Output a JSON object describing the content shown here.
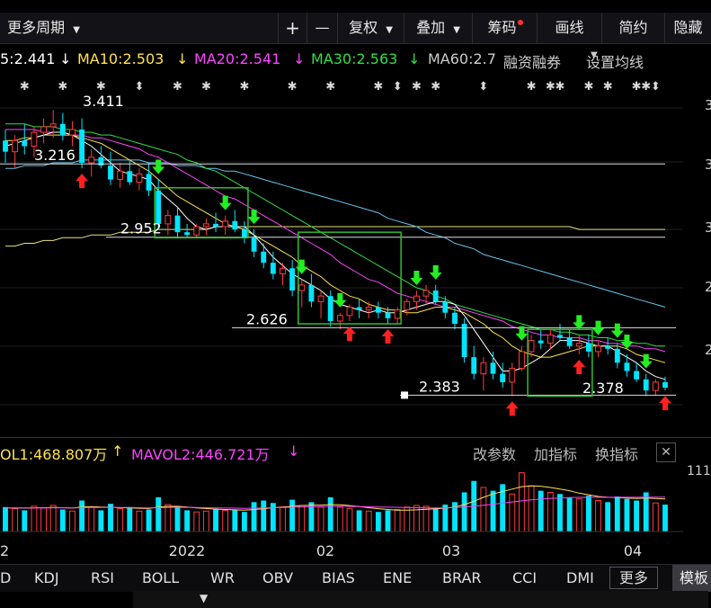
{
  "toolbar": {
    "period_label": "更多周期",
    "plus_label": "+",
    "minus_label": "—",
    "adjust_label": "复权",
    "overlay_label": "叠加",
    "chips_label": "筹码",
    "draw_label": "画线",
    "simple_label": "简约",
    "hide_label": "隐藏"
  },
  "ma_legend": {
    "ma5": "5:2.441",
    "ma10": "MA10:2.503",
    "ma20": "MA20:2.541",
    "ma30": "MA30:2.563",
    "ma60": "MA60:2.7",
    "margin_label": "融资融券",
    "settings_label": "设置均线",
    "arrow_down": "↓",
    "colors": {
      "ma5": "#ffffff",
      "ma10": "#ffe14d",
      "ma20": "#ff44ff",
      "ma30": "#33dd44",
      "ma60": "#cccccc"
    }
  },
  "vol_legend": {
    "mavol1": "OL1:468.807万",
    "mavol1_arrow": "↑",
    "mavol2": "MAVOL2:446.721万",
    "mavol2_arrow": "↓",
    "params_label": "改参数",
    "add_indicator_label": "加指标",
    "switch_indicator_label": "换指标",
    "close_label": "✕",
    "vol_axis_label": "111"
  },
  "indicators": {
    "items": [
      "D",
      "KDJ",
      "RSI",
      "BOLL",
      "WR",
      "OBV",
      "BIAS",
      "ENE",
      "BRAR",
      "CCI",
      "DMI"
    ],
    "more_label": "更多",
    "template_label": "模板"
  },
  "chart_data": {
    "type": "candlestick",
    "x_labels": [
      "2",
      "2022",
      "02",
      "03",
      "04"
    ],
    "price_annotations": [
      "3.411",
      "3.216",
      "2.952",
      "2.626",
      "2.383",
      "2.378"
    ],
    "right_axis_digits": [
      "3",
      "3",
      "3",
      "2",
      "2"
    ],
    "colors": {
      "up": "#ff3b3b",
      "down": "#00e5ff",
      "signal_up": "#ff2020",
      "signal_down": "#22ee22",
      "box": "#2fbf2f"
    },
    "candles": [
      {
        "o": 3.3,
        "h": 3.34,
        "l": 3.22,
        "c": 3.26
      },
      {
        "o": 3.26,
        "h": 3.32,
        "l": 3.2,
        "c": 3.3
      },
      {
        "o": 3.3,
        "h": 3.36,
        "l": 3.25,
        "c": 3.28
      },
      {
        "o": 3.28,
        "h": 3.35,
        "l": 3.24,
        "c": 3.33
      },
      {
        "o": 3.33,
        "h": 3.38,
        "l": 3.29,
        "c": 3.35
      },
      {
        "o": 3.35,
        "h": 3.41,
        "l": 3.31,
        "c": 3.36
      },
      {
        "o": 3.36,
        "h": 3.4,
        "l": 3.3,
        "c": 3.32
      },
      {
        "o": 3.32,
        "h": 3.37,
        "l": 3.28,
        "c": 3.34
      },
      {
        "o": 3.34,
        "h": 3.38,
        "l": 3.2,
        "c": 3.22
      },
      {
        "o": 3.22,
        "h": 3.27,
        "l": 3.17,
        "c": 3.24
      },
      {
        "o": 3.24,
        "h": 3.28,
        "l": 3.2,
        "c": 3.21
      },
      {
        "o": 3.21,
        "h": 3.26,
        "l": 3.14,
        "c": 3.16
      },
      {
        "o": 3.16,
        "h": 3.22,
        "l": 3.13,
        "c": 3.19
      },
      {
        "o": 3.19,
        "h": 3.23,
        "l": 3.14,
        "c": 3.15
      },
      {
        "o": 3.15,
        "h": 3.2,
        "l": 3.12,
        "c": 3.18
      },
      {
        "o": 3.18,
        "h": 3.22,
        "l": 3.1,
        "c": 3.12
      },
      {
        "o": 3.12,
        "h": 3.16,
        "l": 2.98,
        "c": 3.0
      },
      {
        "o": 3.0,
        "h": 3.05,
        "l": 2.96,
        "c": 3.03
      },
      {
        "o": 3.03,
        "h": 3.06,
        "l": 2.95,
        "c": 2.97
      },
      {
        "o": 2.97,
        "h": 3.0,
        "l": 2.95,
        "c": 2.96
      },
      {
        "o": 2.96,
        "h": 3.0,
        "l": 2.95,
        "c": 2.99
      },
      {
        "o": 2.99,
        "h": 3.02,
        "l": 2.96,
        "c": 3.0
      },
      {
        "o": 3.0,
        "h": 3.04,
        "l": 2.97,
        "c": 2.99
      },
      {
        "o": 2.99,
        "h": 3.03,
        "l": 2.96,
        "c": 3.01
      },
      {
        "o": 3.01,
        "h": 3.05,
        "l": 2.97,
        "c": 2.98
      },
      {
        "o": 2.98,
        "h": 3.01,
        "l": 2.93,
        "c": 2.95
      },
      {
        "o": 2.95,
        "h": 2.98,
        "l": 2.88,
        "c": 2.9
      },
      {
        "o": 2.9,
        "h": 2.93,
        "l": 2.84,
        "c": 2.86
      },
      {
        "o": 2.86,
        "h": 2.9,
        "l": 2.8,
        "c": 2.82
      },
      {
        "o": 2.82,
        "h": 2.86,
        "l": 2.78,
        "c": 2.84
      },
      {
        "o": 2.84,
        "h": 2.87,
        "l": 2.74,
        "c": 2.76
      },
      {
        "o": 2.76,
        "h": 2.8,
        "l": 2.7,
        "c": 2.78
      },
      {
        "o": 2.78,
        "h": 2.82,
        "l": 2.7,
        "c": 2.72
      },
      {
        "o": 2.72,
        "h": 2.76,
        "l": 2.66,
        "c": 2.74
      },
      {
        "o": 2.74,
        "h": 2.76,
        "l": 2.63,
        "c": 2.65
      },
      {
        "o": 2.65,
        "h": 2.68,
        "l": 2.62,
        "c": 2.67
      },
      {
        "o": 2.67,
        "h": 2.71,
        "l": 2.65,
        "c": 2.7
      },
      {
        "o": 2.7,
        "h": 2.73,
        "l": 2.66,
        "c": 2.69
      },
      {
        "o": 2.69,
        "h": 2.72,
        "l": 2.66,
        "c": 2.7
      },
      {
        "o": 2.7,
        "h": 2.72,
        "l": 2.66,
        "c": 2.68
      },
      {
        "o": 2.68,
        "h": 2.7,
        "l": 2.64,
        "c": 2.66
      },
      {
        "o": 2.66,
        "h": 2.7,
        "l": 2.64,
        "c": 2.69
      },
      {
        "o": 2.69,
        "h": 2.73,
        "l": 2.67,
        "c": 2.72
      },
      {
        "o": 2.72,
        "h": 2.76,
        "l": 2.69,
        "c": 2.74
      },
      {
        "o": 2.74,
        "h": 2.78,
        "l": 2.71,
        "c": 2.76
      },
      {
        "o": 2.76,
        "h": 2.78,
        "l": 2.71,
        "c": 2.72
      },
      {
        "o": 2.72,
        "h": 2.74,
        "l": 2.66,
        "c": 2.68
      },
      {
        "o": 2.68,
        "h": 2.7,
        "l": 2.62,
        "c": 2.64
      },
      {
        "o": 2.64,
        "h": 2.66,
        "l": 2.5,
        "c": 2.52
      },
      {
        "o": 2.52,
        "h": 2.56,
        "l": 2.44,
        "c": 2.46
      },
      {
        "o": 2.46,
        "h": 2.52,
        "l": 2.4,
        "c": 2.5
      },
      {
        "o": 2.5,
        "h": 2.54,
        "l": 2.44,
        "c": 2.46
      },
      {
        "o": 2.46,
        "h": 2.5,
        "l": 2.41,
        "c": 2.43
      },
      {
        "o": 2.43,
        "h": 2.5,
        "l": 2.38,
        "c": 2.48
      },
      {
        "o": 2.48,
        "h": 2.56,
        "l": 2.47,
        "c": 2.54
      },
      {
        "o": 2.54,
        "h": 2.6,
        "l": 2.52,
        "c": 2.58
      },
      {
        "o": 2.58,
        "h": 2.62,
        "l": 2.55,
        "c": 2.57
      },
      {
        "o": 2.57,
        "h": 2.62,
        "l": 2.55,
        "c": 2.6
      },
      {
        "o": 2.6,
        "h": 2.64,
        "l": 2.58,
        "c": 2.59
      },
      {
        "o": 2.59,
        "h": 2.62,
        "l": 2.55,
        "c": 2.56
      },
      {
        "o": 2.56,
        "h": 2.6,
        "l": 2.53,
        "c": 2.57
      },
      {
        "o": 2.57,
        "h": 2.6,
        "l": 2.52,
        "c": 2.54
      },
      {
        "o": 2.54,
        "h": 2.58,
        "l": 2.52,
        "c": 2.56
      },
      {
        "o": 2.56,
        "h": 2.59,
        "l": 2.53,
        "c": 2.55
      },
      {
        "o": 2.55,
        "h": 2.57,
        "l": 2.48,
        "c": 2.5
      },
      {
        "o": 2.5,
        "h": 2.53,
        "l": 2.45,
        "c": 2.47
      },
      {
        "o": 2.47,
        "h": 2.5,
        "l": 2.43,
        "c": 2.44
      },
      {
        "o": 2.44,
        "h": 2.46,
        "l": 2.38,
        "c": 2.4
      },
      {
        "o": 2.4,
        "h": 2.44,
        "l": 2.38,
        "c": 2.43
      },
      {
        "o": 2.43,
        "h": 2.45,
        "l": 2.4,
        "c": 2.41
      }
    ],
    "ma5": [
      3.28,
      3.29,
      3.3,
      3.31,
      3.32,
      3.33,
      3.33,
      3.32,
      3.3,
      3.28,
      3.25,
      3.22,
      3.19,
      3.18,
      3.17,
      3.16,
      3.12,
      3.09,
      3.06,
      3.02,
      2.99,
      2.98,
      2.99,
      2.99,
      2.99,
      2.99,
      2.96,
      2.92,
      2.88,
      2.85,
      2.82,
      2.8,
      2.78,
      2.76,
      2.73,
      2.71,
      2.7,
      2.69,
      2.68,
      2.69,
      2.68,
      2.68,
      2.69,
      2.7,
      2.71,
      2.72,
      2.72,
      2.71,
      2.67,
      2.62,
      2.57,
      2.52,
      2.47,
      2.47,
      2.48,
      2.5,
      2.52,
      2.55,
      2.58,
      2.58,
      2.58,
      2.57,
      2.56,
      2.56,
      2.54,
      2.52,
      2.5,
      2.47,
      2.45,
      2.44
    ],
    "ma10": [
      3.3,
      3.3,
      3.31,
      3.31,
      3.32,
      3.32,
      3.32,
      3.32,
      3.31,
      3.3,
      3.29,
      3.27,
      3.25,
      3.23,
      3.21,
      3.19,
      3.16,
      3.13,
      3.1,
      3.08,
      3.06,
      3.04,
      3.02,
      3.0,
      2.99,
      2.98,
      2.96,
      2.94,
      2.92,
      2.9,
      2.88,
      2.85,
      2.83,
      2.81,
      2.78,
      2.76,
      2.74,
      2.73,
      2.71,
      2.7,
      2.69,
      2.69,
      2.68,
      2.68,
      2.69,
      2.7,
      2.7,
      2.69,
      2.68,
      2.66,
      2.64,
      2.61,
      2.59,
      2.56,
      2.54,
      2.53,
      2.52,
      2.52,
      2.53,
      2.54,
      2.55,
      2.56,
      2.56,
      2.56,
      2.56,
      2.55,
      2.53,
      2.52,
      2.51,
      2.5
    ],
    "ma20": [
      3.34,
      3.34,
      3.34,
      3.34,
      3.33,
      3.33,
      3.33,
      3.32,
      3.32,
      3.31,
      3.31,
      3.3,
      3.29,
      3.28,
      3.27,
      3.25,
      3.24,
      3.22,
      3.2,
      3.18,
      3.16,
      3.14,
      3.12,
      3.1,
      3.09,
      3.07,
      3.05,
      3.03,
      3.01,
      2.99,
      2.97,
      2.95,
      2.93,
      2.91,
      2.89,
      2.86,
      2.84,
      2.82,
      2.8,
      2.79,
      2.77,
      2.75,
      2.74,
      2.73,
      2.72,
      2.71,
      2.7,
      2.7,
      2.69,
      2.68,
      2.67,
      2.66,
      2.65,
      2.63,
      2.62,
      2.61,
      2.6,
      2.6,
      2.59,
      2.59,
      2.59,
      2.58,
      2.58,
      2.57,
      2.57,
      2.56,
      2.56,
      2.55,
      2.55,
      2.54
    ],
    "ma30": [
      3.36,
      3.36,
      3.36,
      3.35,
      3.35,
      3.35,
      3.34,
      3.34,
      3.33,
      3.33,
      3.32,
      3.32,
      3.31,
      3.3,
      3.29,
      3.28,
      3.27,
      3.26,
      3.25,
      3.23,
      3.22,
      3.2,
      3.19,
      3.17,
      3.15,
      3.13,
      3.11,
      3.09,
      3.07,
      3.05,
      3.03,
      3.01,
      2.99,
      2.97,
      2.95,
      2.93,
      2.91,
      2.89,
      2.87,
      2.85,
      2.83,
      2.81,
      2.79,
      2.77,
      2.76,
      2.74,
      2.73,
      2.71,
      2.7,
      2.69,
      2.68,
      2.67,
      2.66,
      2.65,
      2.64,
      2.63,
      2.62,
      2.62,
      2.61,
      2.61,
      2.6,
      2.6,
      2.59,
      2.59,
      2.58,
      2.58,
      2.57,
      2.57,
      2.56,
      2.56
    ],
    "ma60": [
      3.2,
      3.2,
      3.21,
      3.21,
      3.21,
      3.22,
      3.22,
      3.22,
      3.23,
      3.23,
      3.23,
      3.23,
      3.23,
      3.23,
      3.23,
      3.22,
      3.22,
      3.22,
      3.21,
      3.21,
      3.21,
      3.2,
      3.2,
      3.19,
      3.19,
      3.18,
      3.17,
      3.16,
      3.15,
      3.14,
      3.13,
      3.12,
      3.11,
      3.1,
      3.09,
      3.08,
      3.07,
      3.06,
      3.05,
      3.04,
      3.02,
      3.01,
      3.0,
      2.99,
      2.97,
      2.96,
      2.95,
      2.93,
      2.92,
      2.91,
      2.89,
      2.88,
      2.87,
      2.86,
      2.85,
      2.84,
      2.83,
      2.82,
      2.81,
      2.8,
      2.79,
      2.78,
      2.77,
      2.76,
      2.75,
      2.74,
      2.73,
      2.72,
      2.71,
      2.7
    ],
    "ma_long": [
      2.92,
      2.92,
      2.93,
      2.93,
      2.94,
      2.94,
      2.95,
      2.95,
      2.95,
      2.96,
      2.96,
      2.96,
      2.97,
      2.97,
      2.97,
      2.97,
      2.98,
      2.98,
      2.98,
      2.98,
      2.98,
      2.98,
      2.99,
      2.99,
      2.99,
      2.99,
      2.99,
      2.99,
      2.99,
      2.99,
      2.99,
      2.99,
      2.99,
      2.99,
      2.99,
      2.99,
      2.99,
      2.99,
      2.99,
      2.99,
      2.99,
      2.99,
      2.99,
      2.99,
      2.99,
      2.99,
      2.99,
      2.99,
      2.99,
      2.99,
      2.99,
      2.99,
      2.99,
      2.99,
      2.99,
      2.99,
      2.99,
      2.99,
      2.99,
      2.99,
      2.98,
      2.98,
      2.98,
      2.98,
      2.98,
      2.98,
      2.98,
      2.98,
      2.98,
      2.98
    ],
    "volume": [
      300,
      280,
      260,
      310,
      290,
      320,
      270,
      250,
      380,
      300,
      260,
      340,
      280,
      300,
      250,
      270,
      420,
      330,
      300,
      260,
      240,
      250,
      280,
      260,
      270,
      240,
      360,
      380,
      350,
      300,
      390,
      320,
      360,
      300,
      420,
      300,
      280,
      260,
      250,
      240,
      260,
      270,
      300,
      320,
      310,
      290,
      330,
      360,
      480,
      620,
      540,
      500,
      580,
      460,
      720,
      560,
      500,
      480,
      460,
      420,
      400,
      440,
      380,
      360,
      430,
      400,
      380,
      480,
      350,
      330
    ],
    "mavol1": [
      290,
      290,
      288,
      290,
      292,
      294,
      292,
      288,
      300,
      305,
      300,
      298,
      292,
      290,
      285,
      282,
      300,
      308,
      310,
      300,
      290,
      282,
      274,
      270,
      266,
      262,
      270,
      280,
      292,
      300,
      310,
      318,
      324,
      324,
      330,
      328,
      318,
      306,
      292,
      280,
      270,
      262,
      262,
      266,
      272,
      278,
      286,
      300,
      330,
      370,
      420,
      460,
      490,
      520,
      550,
      560,
      555,
      540,
      520,
      500,
      470,
      450,
      430,
      420,
      415,
      410,
      405,
      410,
      405,
      400
    ],
    "mavol2": [
      290,
      290,
      289,
      289,
      290,
      291,
      291,
      290,
      292,
      294,
      295,
      296,
      295,
      294,
      292,
      290,
      292,
      295,
      297,
      296,
      294,
      292,
      290,
      288,
      286,
      284,
      286,
      289,
      292,
      295,
      298,
      301,
      304,
      306,
      308,
      309,
      308,
      306,
      303,
      300,
      298,
      296,
      294,
      292,
      290,
      289,
      290,
      294,
      300,
      310,
      322,
      335,
      348,
      362,
      376,
      388,
      398,
      406,
      412,
      416,
      418,
      419,
      420,
      420,
      420,
      420,
      420,
      421,
      421,
      421
    ]
  }
}
